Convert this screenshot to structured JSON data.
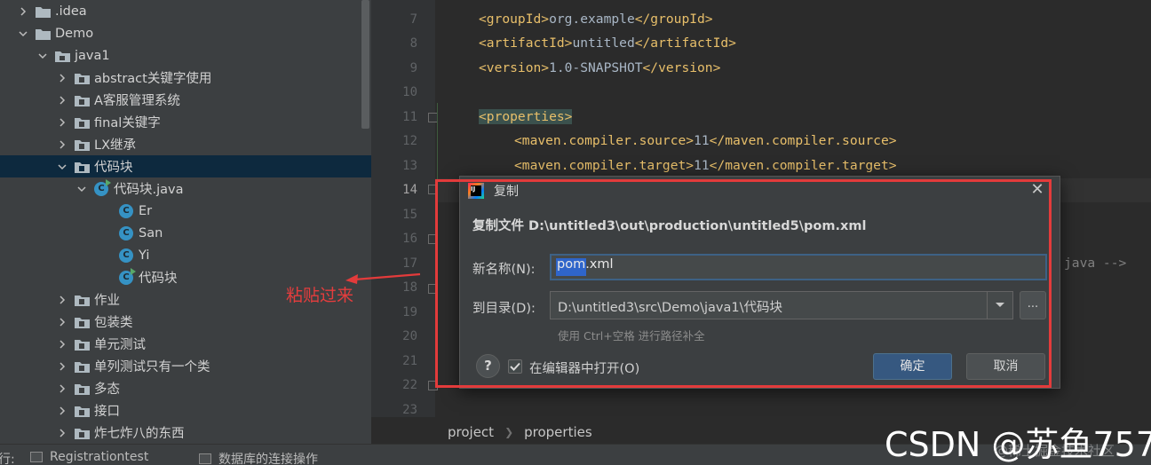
{
  "project_tree": {
    "items": [
      {
        "label": ".idea",
        "depth": 0,
        "type": "folder",
        "expanded": false
      },
      {
        "label": "Demo",
        "depth": 0,
        "type": "folder",
        "expanded": true
      },
      {
        "label": "java1",
        "depth": 1,
        "type": "folder",
        "expanded": true
      },
      {
        "label": "abstract关键字使用",
        "depth": 2,
        "type": "package",
        "expanded": false
      },
      {
        "label": "A客服管理系统",
        "depth": 2,
        "type": "package",
        "expanded": false
      },
      {
        "label": "final关键字",
        "depth": 2,
        "type": "package",
        "expanded": false
      },
      {
        "label": "LX继承",
        "depth": 2,
        "type": "package",
        "expanded": false
      },
      {
        "label": "代码块",
        "depth": 2,
        "type": "package",
        "expanded": true,
        "selected": true
      },
      {
        "label": "代码块.java",
        "depth": 3,
        "type": "java-file",
        "expanded": true
      },
      {
        "label": "Er",
        "depth": 4,
        "type": "class"
      },
      {
        "label": "San",
        "depth": 4,
        "type": "class"
      },
      {
        "label": "Yi",
        "depth": 4,
        "type": "class"
      },
      {
        "label": "代码块",
        "depth": 4,
        "type": "class-main"
      },
      {
        "label": "作业",
        "depth": 2,
        "type": "package",
        "expanded": false
      },
      {
        "label": "包装类",
        "depth": 2,
        "type": "package",
        "expanded": false
      },
      {
        "label": "单元测试",
        "depth": 2,
        "type": "package",
        "expanded": false
      },
      {
        "label": "单列测试只有一个类",
        "depth": 2,
        "type": "package",
        "expanded": false
      },
      {
        "label": "多态",
        "depth": 2,
        "type": "package",
        "expanded": false
      },
      {
        "label": "接口",
        "depth": 2,
        "type": "package",
        "expanded": false
      },
      {
        "label": "炸七炸八的东西",
        "depth": 2,
        "type": "package",
        "expanded": false
      }
    ]
  },
  "editor": {
    "line_numbers": [
      "7",
      "8",
      "9",
      "10",
      "11",
      "12",
      "13",
      "14",
      "15",
      "16",
      "17",
      "18",
      "19",
      "20",
      "21",
      "22",
      "23"
    ],
    "current_line": "14",
    "lines": [
      {
        "open": "<groupId>",
        "text": "org.example",
        "close": "</groupId>"
      },
      {
        "open": "<artifactId>",
        "text": "untitled",
        "close": "</artifactId>"
      },
      {
        "open": "<version>",
        "text": "1.0-SNAPSHOT",
        "close": "</version>"
      },
      {
        "open": "<properties>"
      },
      {
        "open": "<maven.compiler.source>",
        "text": "11",
        "close": "</maven.compiler.source>"
      },
      {
        "open": "<maven.compiler.target>",
        "text": "11",
        "close": "</maven.compiler.target>"
      }
    ],
    "comment_fragment": "java -->",
    "breadcrumb": [
      "project",
      "properties"
    ]
  },
  "bottom_tabs": [
    "Registrationtest",
    "数据库的连接操作"
  ],
  "bottom_prefix": "行:",
  "dialog": {
    "title": "复制",
    "heading": "复制文件 D:\\untitled3\\out\\production\\untitled5\\pom.xml",
    "name_label": "新名称(N):",
    "name_value": "pom.xml",
    "dir_label": "到目录(D):",
    "dir_value": "D:\\untitled3\\src\\Demo\\java1\\代码块",
    "hint": "使用 Ctrl+空格 进行路径补全",
    "open_in_editor_label": "在编辑器中打开(O)",
    "open_in_editor_checked": true,
    "ok_label": "确定",
    "cancel_label": "取消",
    "help_label": "?",
    "browse_label": "..."
  },
  "annotation": {
    "text": "粘贴过来",
    "color": "#e53d3d"
  },
  "watermark": {
    "text": "CSDN @苏鱼757",
    "sub": "@稀土掘金技术社区"
  },
  "colors": {
    "accent": "#365880",
    "selection": "#0d293e",
    "tag": "#e8bf6a",
    "annotation": "#e33b3b"
  }
}
